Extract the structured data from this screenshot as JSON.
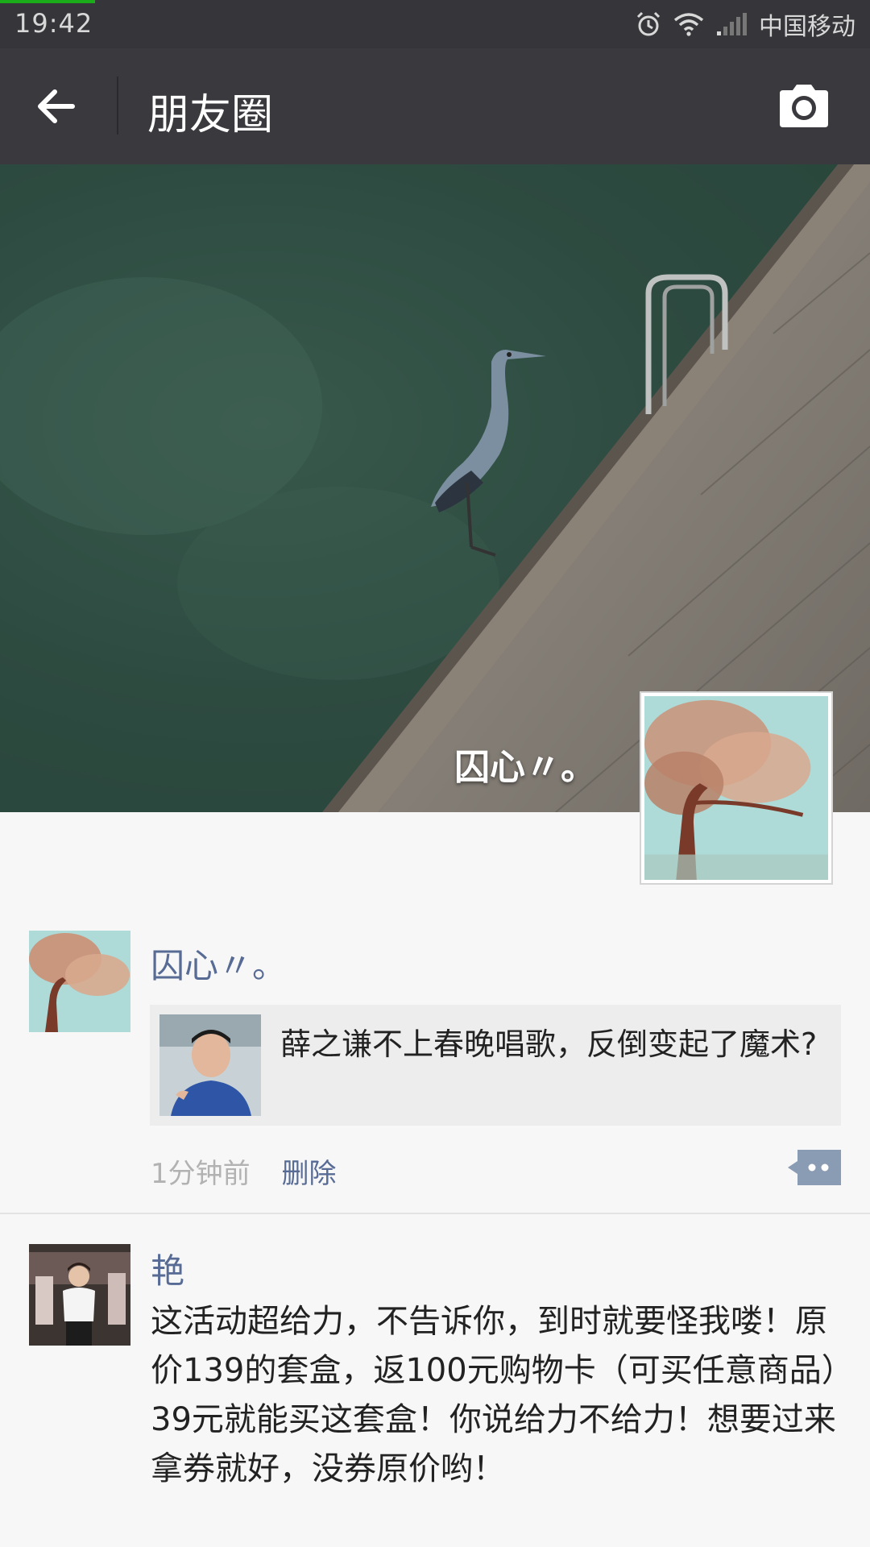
{
  "status_bar": {
    "time": "19:42",
    "carrier": "中国移动",
    "icons": [
      "alarm-icon",
      "wifi-icon",
      "signal-icon"
    ]
  },
  "nav": {
    "title": "朋友圈",
    "back_icon": "arrow-left-icon",
    "camera_icon": "camera-icon"
  },
  "cover": {
    "name": "囚心〃。"
  },
  "posts": [
    {
      "username": "囚心〃。",
      "share": {
        "text": "薛之谦不上春晚唱歌，反倒变起了魔术?"
      },
      "time": "1分钟前",
      "delete_label": "删除"
    },
    {
      "username": "艳",
      "text": "这活动超给力，不告诉你，到时就要怪我喽！原价139的套盒，返100元购物卡（可买任意商品）39元就能买这套盒！你说给力不给力！想要过来拿券就好，没券原价哟！"
    }
  ],
  "colors": {
    "nav_bg": "#3a393e",
    "status_bg": "#36363a",
    "link": "#576b95",
    "page_bg": "#f7f7f7"
  }
}
